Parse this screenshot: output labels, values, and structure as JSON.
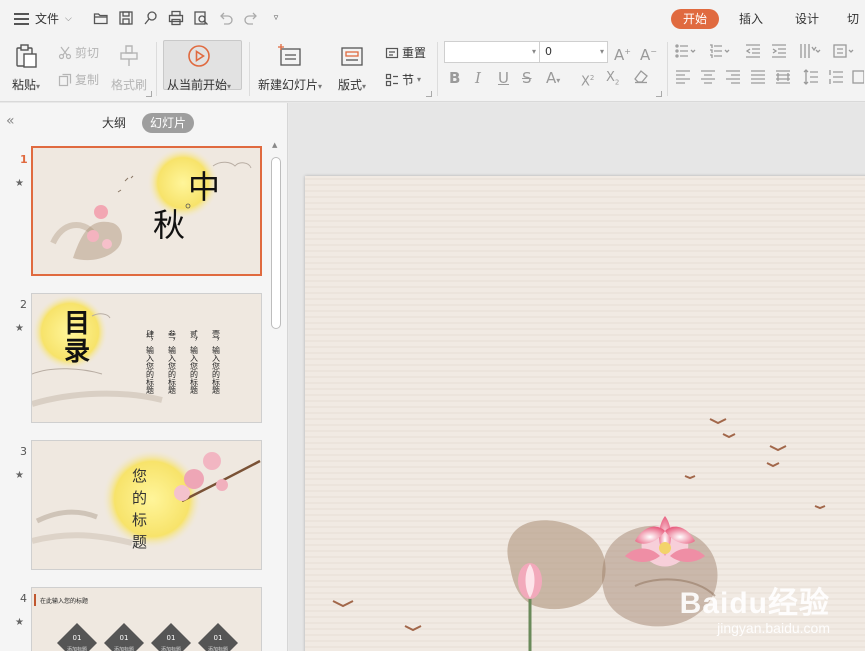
{
  "topbar": {
    "menu_label": "文件",
    "tabs": [
      {
        "label": "开始",
        "active": true
      },
      {
        "label": "插入",
        "active": false
      },
      {
        "label": "设计",
        "active": false
      },
      {
        "label": "切换",
        "active": false
      }
    ],
    "accent_color": "#e06a3f"
  },
  "ribbon": {
    "paste": "粘贴",
    "cut": "剪切",
    "copy": "复制",
    "format_painter": "格式刷",
    "play_from_current": "从当前开始",
    "new_slide": "新建幻灯片",
    "layout": "版式",
    "reset": "重置",
    "section": "节",
    "font_size": "0"
  },
  "panel": {
    "tab_outline": "大纲",
    "tab_slides": "幻灯片",
    "slides": [
      {
        "number": "1",
        "title_line1": "中",
        "title_line2": "秋"
      },
      {
        "number": "2",
        "title": "目录",
        "columns": [
          "壹，输入您的标题",
          "贰，输入您的标题",
          "叁，输入您的标题",
          "肆，输入您的标题"
        ]
      },
      {
        "number": "3",
        "title": "您的标题"
      },
      {
        "number": "4",
        "header": "在此输入您的标题",
        "item_number": "01",
        "item_label": "添加标题"
      }
    ]
  },
  "watermark": {
    "brand": "Baidu经验",
    "url": "jingyan.baidu.com"
  }
}
